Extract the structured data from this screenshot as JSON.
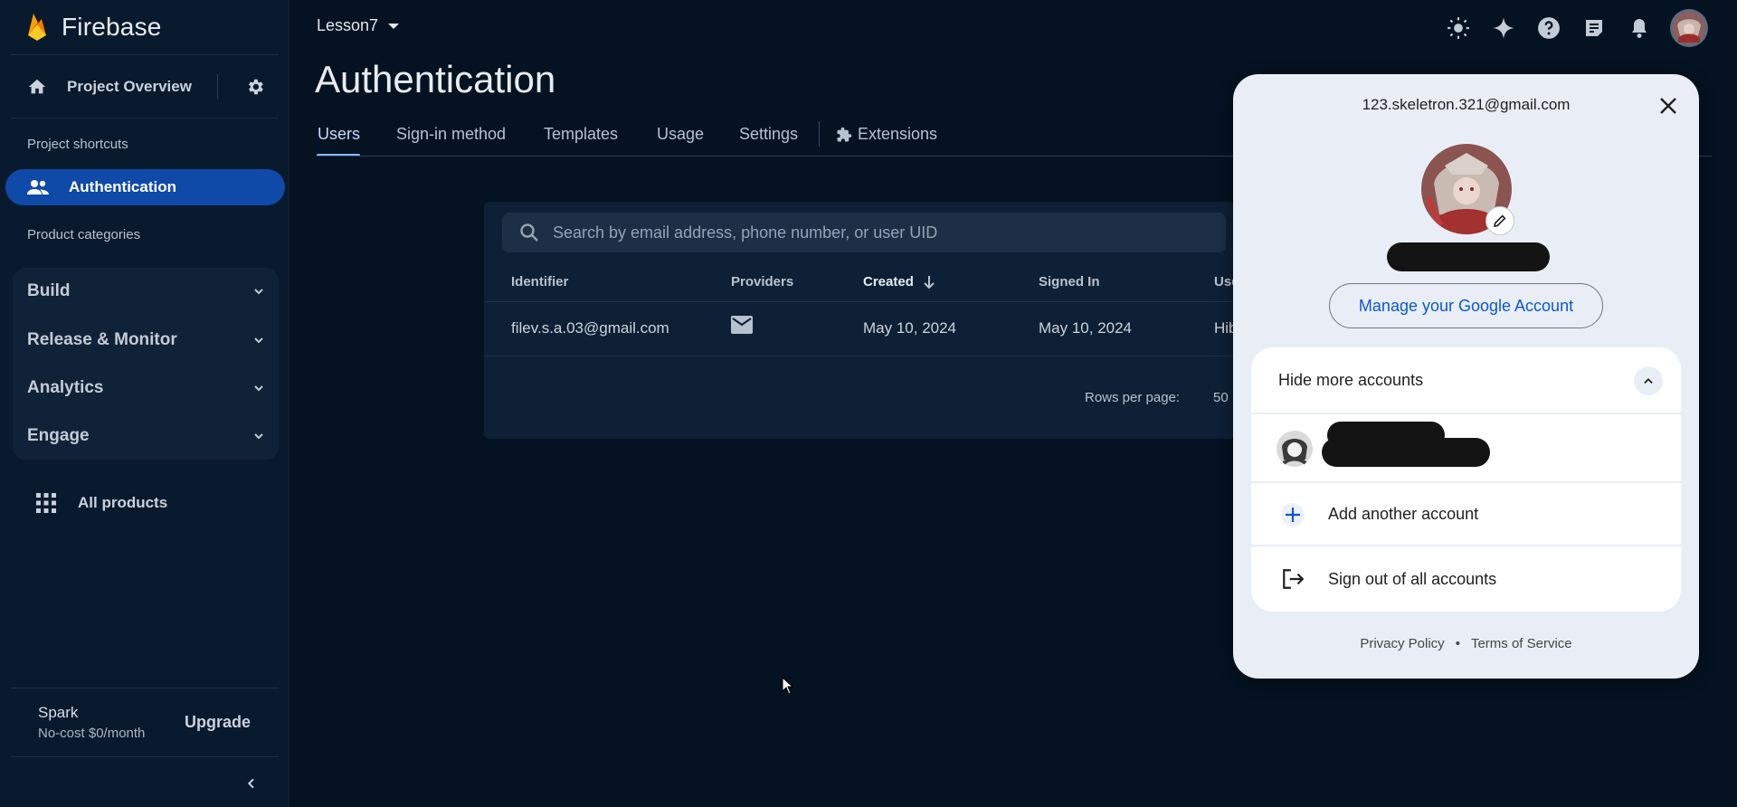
{
  "colors": {
    "background": "#041221",
    "sidebar": "#0a1a2e",
    "active_item": "#0f4aa8",
    "accent": "#8ab4f8",
    "link_blue": "#0b57d0",
    "popup_bg": "#e9eef6"
  },
  "sidebar": {
    "brand": "Firebase",
    "project_overview": "Project Overview",
    "shortcuts_label": "Project shortcuts",
    "active_shortcut": "Authentication",
    "categories_label": "Product categories",
    "categories": [
      {
        "label": "Build"
      },
      {
        "label": "Release & Monitor"
      },
      {
        "label": "Analytics"
      },
      {
        "label": "Engage"
      }
    ],
    "all_products": "All products",
    "plan_name": "Spark",
    "plan_desc": "No-cost $0/month",
    "upgrade": "Upgrade"
  },
  "header": {
    "project": "Lesson7",
    "icons": [
      "theme-icon",
      "gemini-icon",
      "help-icon",
      "notes-icon",
      "notifications-icon",
      "account-avatar"
    ]
  },
  "page": {
    "title": "Authentication",
    "tabs": [
      {
        "label": "Users",
        "active": true
      },
      {
        "label": "Sign-in method"
      },
      {
        "label": "Templates"
      },
      {
        "label": "Usage"
      },
      {
        "label": "Settings"
      },
      {
        "label": "Extensions"
      }
    ]
  },
  "users": {
    "search_placeholder": "Search by email address, phone number, or user UID",
    "columns": [
      "Identifier",
      "Providers",
      "Created",
      "Signed In",
      "Use"
    ],
    "rows": [
      {
        "identifier": "filev.s.a.03@gmail.com",
        "provider": "email-icon",
        "created": "May 10, 2024",
        "signed_in": "May 10, 2024",
        "uid": "Hib"
      }
    ],
    "rows_per_page_label": "Rows per page:",
    "rows_per_page": "50"
  },
  "account_popup": {
    "email": "123.skeletron.321@gmail.com",
    "manage": "Manage your Google Account",
    "hide_more": "Hide more accounts",
    "add_account": "Add another account",
    "sign_out": "Sign out of all accounts",
    "privacy": "Privacy Policy",
    "separator": "•",
    "terms": "Terms of Service"
  }
}
